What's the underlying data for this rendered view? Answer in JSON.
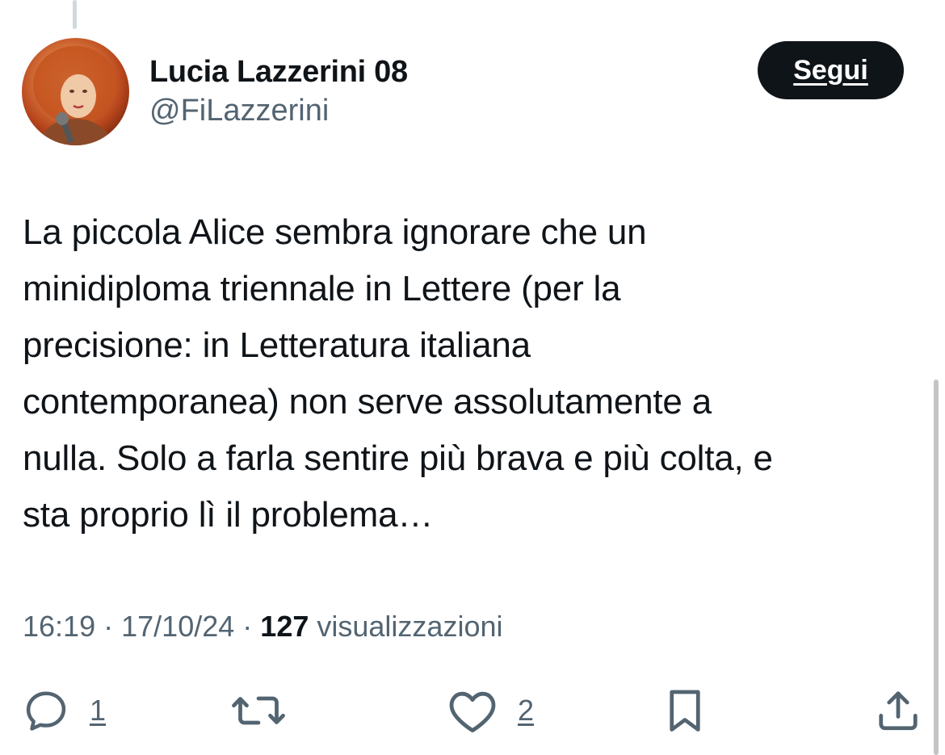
{
  "author": {
    "display_name": "Lucia Lazzerini 08",
    "handle": "@FiLazzerini"
  },
  "follow_button": {
    "label": "Segui"
  },
  "tweet": {
    "text": "La piccola Alice sembra ignorare che un\nminidiploma triennale in Lettere (per la\nprecisione: in Letteratura italiana\ncontemporanea) non serve assolutamente a\nnulla. Solo a farla sentire più brava e più colta, e\nsta proprio lì il problema…",
    "time": "16:19",
    "date": "17/10/24",
    "separator": "·",
    "views_count": "127",
    "views_label": "visualizzazioni"
  },
  "actions": {
    "reply_count": "1",
    "retweet_count": "",
    "like_count": "2"
  },
  "icons": {
    "reply": "reply-icon",
    "retweet": "retweet-icon",
    "like": "heart-icon",
    "bookmark": "bookmark-icon",
    "share": "share-icon"
  },
  "colors": {
    "text": "#0f1419",
    "secondary": "#536471",
    "button_bg": "#0f1419"
  }
}
